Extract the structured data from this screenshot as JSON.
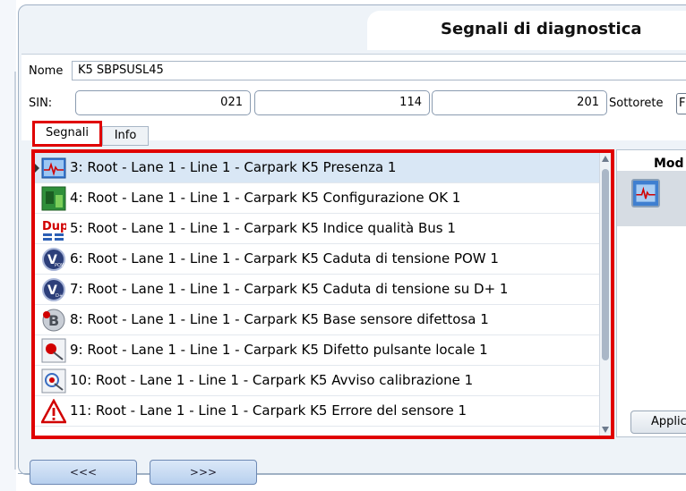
{
  "title": "Segnali di diagnostica",
  "form": {
    "name_label": "Nome",
    "name_value": "K5 SBPSUSL45",
    "sin_label": "SIN:",
    "sin_values": [
      "021",
      "114",
      "201"
    ],
    "subnet_label": "Sottorete",
    "subnet_value_partial": "F"
  },
  "tabs": [
    "Segnali",
    "Info"
  ],
  "signals": [
    {
      "label": "3: Root - Lane 1 - Line 1 - Carpark K5 Presenza 1",
      "icon": "presence-signal-icon",
      "selected": true
    },
    {
      "label": "4: Root - Lane 1 - Line 1 - Carpark K5 Configurazione OK 1",
      "icon": "configuration-ok-icon"
    },
    {
      "label": "5: Root - Lane 1 - Line 1 - Carpark K5 Indice qualità Bus 1",
      "icon": "dup-icon"
    },
    {
      "label": "6: Root - Lane 1 - Line 1 - Carpark K5 Caduta di tensione POW 1",
      "icon": "voltage-drop-pow-icon"
    },
    {
      "label": "7: Root - Lane 1 - Line 1 - Carpark K5 Caduta di tensione su D+ 1",
      "icon": "voltage-drop-d-icon"
    },
    {
      "label": "8: Root - Lane 1 - Line 1 - Carpark K5 Base sensore difettosa 1",
      "icon": "sensor-base-fault-icon"
    },
    {
      "label": "9: Root - Lane 1 - Line 1 - Carpark K5 Difetto pulsante locale 1",
      "icon": "local-button-fault-icon"
    },
    {
      "label": "10: Root - Lane 1 - Line 1 - Carpark K5 Avviso calibrazione 1",
      "icon": "calibration-warning-icon"
    },
    {
      "label": "11: Root - Lane 1 - Line 1 - Carpark K5 Errore del sensore 1",
      "icon": "warning-triangle-icon"
    }
  ],
  "right_panel": {
    "mode_label": "Mod",
    "apply_label": "Applic"
  },
  "nav": {
    "prev_label": "<<<",
    "next_label": ">>>"
  },
  "colors": {
    "highlight_red": "#e00000",
    "selected_row": "#d9e7f5"
  }
}
